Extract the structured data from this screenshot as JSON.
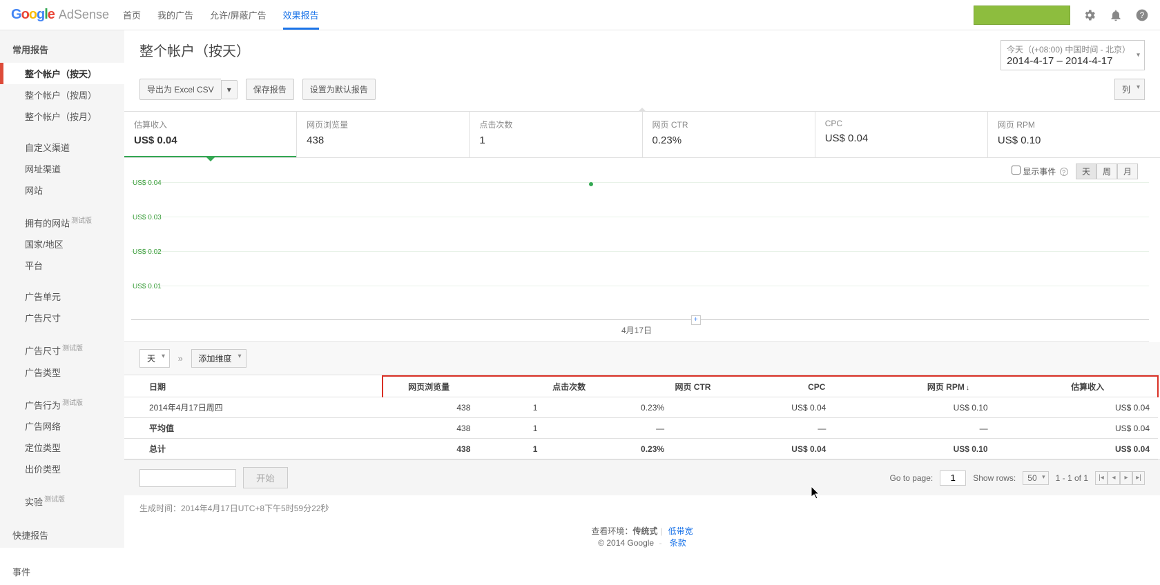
{
  "logo": {
    "adsense": "AdSense"
  },
  "nav": {
    "home": "首页",
    "myads": "我的广告",
    "allow": "允许/屏蔽广告",
    "reports": "效果报告"
  },
  "sidebar": {
    "heading": "常用报告",
    "items": [
      "整个帐户（按天）",
      "整个帐户（按周）",
      "整个帐户（按月）",
      "自定义渠道",
      "网址渠道",
      "网站",
      "拥有的网站",
      "国家/地区",
      "平台",
      "广告单元",
      "广告尺寸",
      "广告尺寸",
      "广告类型",
      "广告行为",
      "广告网络",
      "定位类型",
      "出价类型",
      "实验"
    ],
    "beta": "测试版",
    "quick": "快捷报告",
    "events": "事件"
  },
  "title": "整个帐户（按天）",
  "datepicker": {
    "top": "今天（(+08:00) 中国时间 - 北京）",
    "range": "2014-4-17 – 2014-4-17"
  },
  "toolbar": {
    "export": "导出为 Excel CSV",
    "save": "保存报告",
    "default": "设置为默认报告",
    "columns": "列"
  },
  "metrics": [
    {
      "label": "估算收入",
      "value": "US$ 0.04"
    },
    {
      "label": "网页浏览量",
      "value": "438"
    },
    {
      "label": "点击次数",
      "value": "1"
    },
    {
      "label": "网页 CTR",
      "value": "0.23%"
    },
    {
      "label": "CPC",
      "value": "US$ 0.04"
    },
    {
      "label": "网页 RPM",
      "value": "US$ 0.10"
    }
  ],
  "chart_data": {
    "type": "line",
    "categories": [
      "4月17日"
    ],
    "series": [
      {
        "name": "估算收入",
        "values": [
          0.04
        ]
      }
    ],
    "ylabel": "US$",
    "ylim": [
      0,
      0.04
    ],
    "yticks": [
      "US$ 0.01",
      "US$ 0.02",
      "US$ 0.03",
      "US$ 0.04"
    ]
  },
  "chart_opts": {
    "show_events": "显示事件",
    "day": "天",
    "week": "周",
    "month": "月"
  },
  "dim": {
    "sel": "天",
    "add": "添加维度"
  },
  "table": {
    "headers": [
      "日期",
      "网页浏览量",
      "点击次数",
      "网页 CTR",
      "CPC",
      "网页 RPM",
      "估算收入"
    ],
    "rows": [
      {
        "c0": "2014年4月17日周四",
        "c1": "438",
        "c2": "1",
        "c3": "0.23%",
        "c4": "US$ 0.04",
        "c5": "US$ 0.10",
        "c6": "US$ 0.04"
      }
    ],
    "avg": {
      "c0": "平均值",
      "c1": "438",
      "c2": "1",
      "c3": "—",
      "c4": "—",
      "c5": "—",
      "c6": "US$ 0.04"
    },
    "total": {
      "c0": "总计",
      "c1": "438",
      "c2": "1",
      "c3": "0.23%",
      "c4": "US$ 0.04",
      "c5": "US$ 0.10",
      "c6": "US$ 0.04"
    }
  },
  "pager": {
    "start": "开始",
    "goto": "Go to page:",
    "page": "1",
    "showrows": "Show rows:",
    "rows": "50",
    "range": "1 - 1 of 1"
  },
  "footer": {
    "gen": "生成时间：2014年4月17日UTC+8下午5时59分22秒",
    "env_label": "查看环境：",
    "env_classic": "传统式",
    "env_low": "低带宽",
    "copy": "© 2014 Google",
    "terms": "条款"
  }
}
